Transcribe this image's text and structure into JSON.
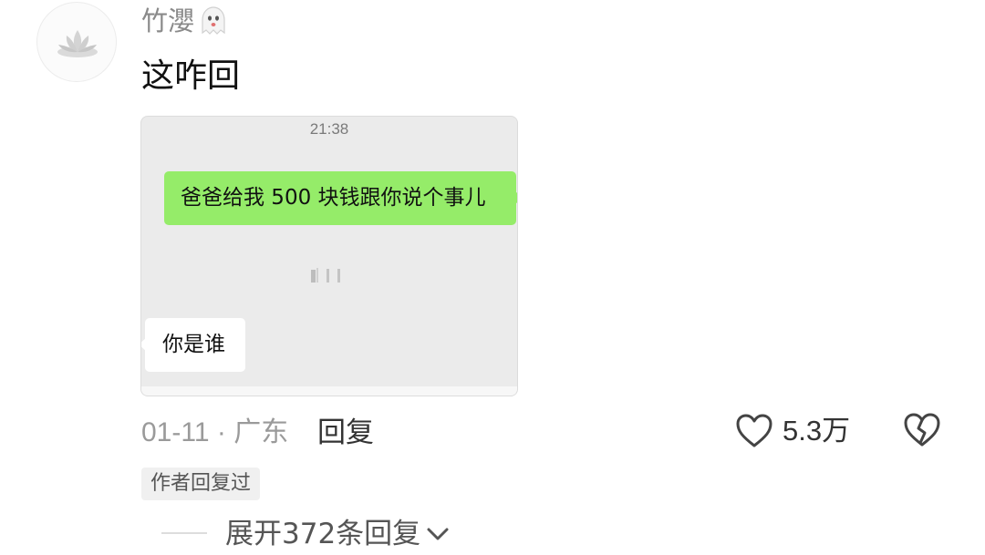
{
  "comment": {
    "username": "竹瀴",
    "username_emoji_icon": "ghost-icon",
    "text": "这咋回",
    "date": "01-11",
    "separator": "·",
    "location": "广东",
    "reply_label": "回复",
    "like_count": "5.3万",
    "author_replied_badge": "作者回复过",
    "expand_replies_label": "展开372条回复"
  },
  "screenshot": {
    "time": "21:38",
    "sent_message": "爸爸给我 500 块钱跟你说个事儿",
    "received_message": "你是谁"
  },
  "colors": {
    "sent_bubble": "#95ec69",
    "chat_background": "#ebebeb",
    "muted_text": "#9a9a9a"
  }
}
